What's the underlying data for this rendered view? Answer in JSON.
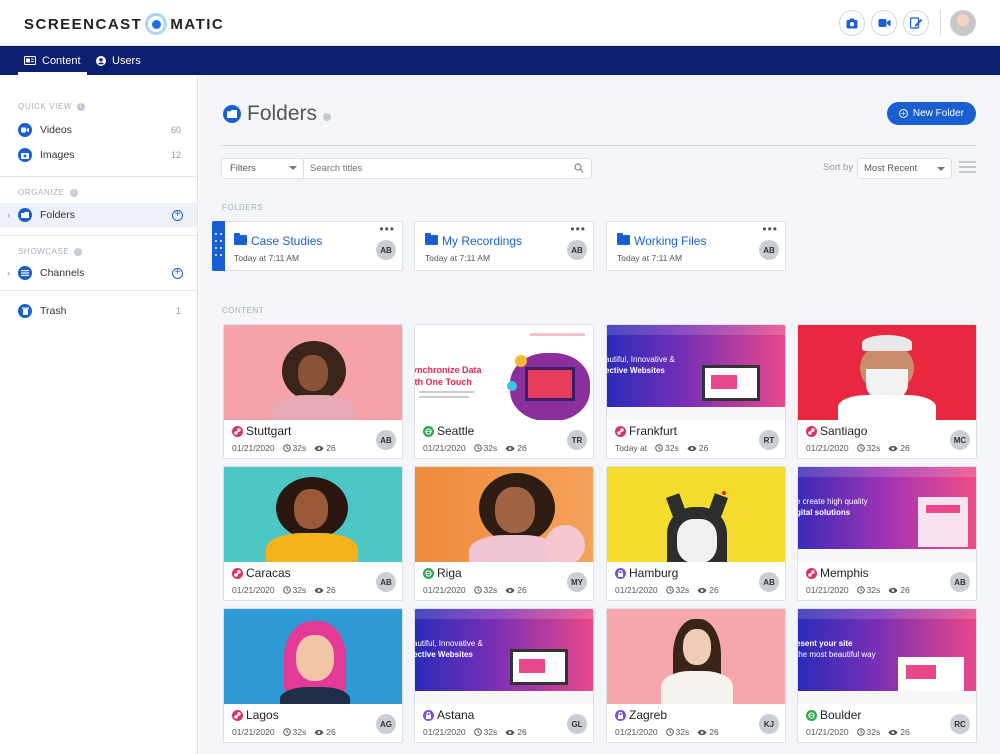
{
  "app": {
    "logo_left": "SCREENCAST",
    "logo_right": "MATIC",
    "top_icons": [
      "camera-icon",
      "video-camera-icon",
      "edit-icon"
    ]
  },
  "nav": {
    "content": "Content",
    "users": "Users"
  },
  "sidebar": {
    "quick_view": "QUICK VIEW",
    "videos": "Videos",
    "videos_count": "60",
    "images": "Images",
    "images_count": "12",
    "organize": "ORGANIZE",
    "folders": "Folders",
    "showcase": "SHOWCASE",
    "channels": "Channels",
    "trash": "Trash",
    "trash_count": "1"
  },
  "main": {
    "title": "Folders",
    "new_folder": "New Folder",
    "filters": "Filters",
    "search_placeholder": "Search titles",
    "sort_by": "Sort by",
    "sort_value": "Most Recent",
    "folders_label": "FOLDERS",
    "content_label": "CONTENT"
  },
  "folders": [
    {
      "name": "Case Studies",
      "date": "Today at 7:11 AM",
      "owner": "AB"
    },
    {
      "name": "My Recordings",
      "date": "Today at 7:11 AM",
      "owner": "AB"
    },
    {
      "name": "Working Files",
      "date": "Today at 7:11 AM",
      "owner": "AB"
    }
  ],
  "content": [
    {
      "title": "Stuttgart",
      "date": "01/21/2020",
      "duration": "32s",
      "views": "26",
      "owner": "AB",
      "status": "link"
    },
    {
      "title": "Seattle",
      "date": "01/21/2020",
      "duration": "32s",
      "views": "26",
      "owner": "TR",
      "status": "public"
    },
    {
      "title": "Frankfurt",
      "date": "Today at",
      "duration": "32s",
      "views": "26",
      "owner": "RT",
      "status": "link"
    },
    {
      "title": "Santiago",
      "date": "01/21/2020",
      "duration": "32s",
      "views": "26",
      "owner": "MC",
      "status": "link"
    },
    {
      "title": "Caracas",
      "date": "01/21/2020",
      "duration": "32s",
      "views": "26",
      "owner": "AB",
      "status": "link"
    },
    {
      "title": "Riga",
      "date": "01/21/2020",
      "duration": "32s",
      "views": "26",
      "owner": "MY",
      "status": "public"
    },
    {
      "title": "Hamburg",
      "date": "01/21/2020",
      "duration": "32s",
      "views": "26",
      "owner": "AB",
      "status": "private"
    },
    {
      "title": "Memphis",
      "date": "01/21/2020",
      "duration": "32s",
      "views": "26",
      "owner": "AB",
      "status": "link"
    },
    {
      "title": "Lagos",
      "date": "01/21/2020",
      "duration": "32s",
      "views": "26",
      "owner": "AG",
      "status": "link"
    },
    {
      "title": "Astana",
      "date": "01/21/2020",
      "duration": "32s",
      "views": "26",
      "owner": "GL",
      "status": "private"
    },
    {
      "title": "Zagreb",
      "date": "01/21/2020",
      "duration": "32s",
      "views": "26",
      "owner": "KJ",
      "status": "private"
    },
    {
      "title": "Boulder",
      "date": "01/21/2020",
      "duration": "32s",
      "views": "26",
      "owner": "RC",
      "status": "public"
    }
  ],
  "thumb_text": {
    "seattle_head_1": "ynchronize Data",
    "seattle_head_2": "ith One Touch",
    "frankfurt_head_1": "autiful, Innovative &",
    "frankfurt_head_2": "ective Websites",
    "memphis_head_1": "e create high quality",
    "memphis_head_2": "gital solutions",
    "astana_head_1": "autiful, Innovative &",
    "astana_head_2": "ective Websites",
    "boulder_head_1": "esent your site",
    "boulder_head_2": "the most beautiful way"
  },
  "colors": {
    "brand": "#1a5fd0",
    "navbar": "#0b1f6e",
    "status_link": "#d6336c",
    "status_public": "#2fa84f",
    "status_private": "#7b4fd6"
  }
}
